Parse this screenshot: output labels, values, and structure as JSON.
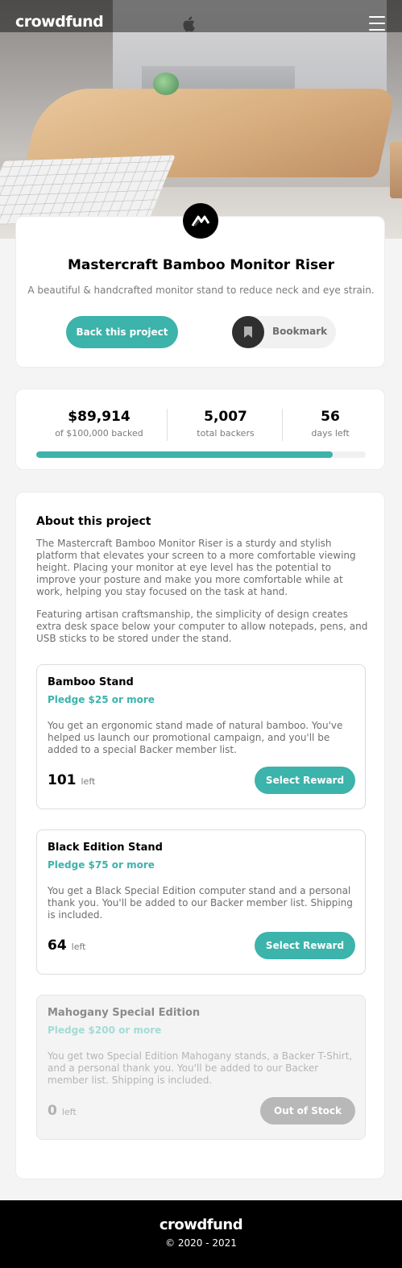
{
  "header": {
    "logo": "crowdfund",
    "menu_icon": "hamburger-icon"
  },
  "project": {
    "logo_icon": "mastercraft-logo-icon",
    "title": "Mastercraft Bamboo Monitor Riser",
    "description": "A beautiful & handcrafted monitor stand to reduce neck and eye strain.",
    "back_label": "Back this project",
    "bookmark_label": "Bookmark",
    "bookmark_icon": "bookmark-icon"
  },
  "stats": {
    "backed_value": "$89,914",
    "backed_label": "of $100,000 backed",
    "backers_value": "5,007",
    "backers_label": "total backers",
    "days_value": "56",
    "days_label": "days left",
    "progress_fraction": 0.899
  },
  "about": {
    "heading": "About this project",
    "paragraph1": "The Mastercraft Bamboo Monitor Riser is a sturdy and stylish platform that elevates your screen to a more comfortable viewing height. Placing your monitor at eye level has the potential to improve your posture and make you more comfortable while at work, helping you stay focused on the task at hand.",
    "paragraph2": "Featuring artisan craftsmanship, the simplicity of design creates extra desk space below your computer to allow notepads, pens, and USB sticks to be stored under the stand."
  },
  "rewards": [
    {
      "name": "Bamboo Stand",
      "pledge": "Pledge $25 or more",
      "description": "You get an ergonomic stand made of natural bamboo. You've helped us launch our promotional campaign, and you'll be added to a special Backer member list.",
      "left_count": "101",
      "left_label": "left",
      "button_label": "Select Reward"
    },
    {
      "name": "Black Edition Stand",
      "pledge": "Pledge $75 or more",
      "description": "You get a Black Special Edition computer stand and a personal thank you. You'll be added to our Backer member list. Shipping is included.",
      "left_count": "64",
      "left_label": "left",
      "button_label": "Select Reward"
    },
    {
      "name": "Mahogany Special Edition",
      "pledge": "Pledge $200 or more",
      "description": "You get two Special Edition Mahogany stands, a Backer T-Shirt, and a personal thank you. You'll be added to our Backer member list. Shipping is included.",
      "left_count": "0",
      "left_label": "left",
      "button_label": "Out of Stock"
    }
  ],
  "footer": {
    "logo": "crowdfund",
    "copyright": "© 2020 - 2021"
  },
  "colors": {
    "accent": "#3cb3ab",
    "accent_light": "#a4dbd7",
    "disabled": "#b8b8b8",
    "text_dark": "#000000",
    "text_muted": "#7a7a7a"
  }
}
